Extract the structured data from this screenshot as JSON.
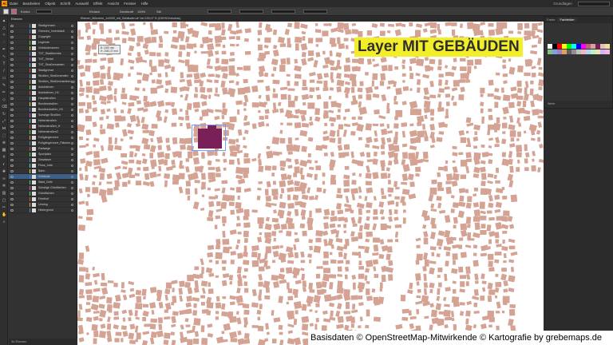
{
  "app": {
    "logo": "Ai"
  },
  "menu": {
    "items": [
      "Datei",
      "Bearbeiten",
      "Objekt",
      "Schrift",
      "Auswahl",
      "Effekt",
      "Ansicht",
      "Fenster",
      "Hilfe"
    ]
  },
  "topright": {
    "workspace": "Grundlagen"
  },
  "control": {
    "fill_color": "#c0607a",
    "stroke_label": "Kontur",
    "opacity_label": "Deckkraft",
    "opacity_value": "100%",
    "stil_label": "Stil",
    "basic": "Einfach"
  },
  "tools": {
    "icons": [
      "select-arrow",
      "direct-select",
      "magic-wand",
      "lasso",
      "pen",
      "curvature",
      "type",
      "line",
      "rectangle",
      "paintbrush",
      "pencil",
      "shaper",
      "eraser",
      "rotate",
      "scale",
      "width",
      "free-transform",
      "shape-builder",
      "perspective",
      "mesh",
      "gradient",
      "eyedropper",
      "blend",
      "symbol-sprayer",
      "graph",
      "artboard",
      "slice",
      "hand",
      "zoom"
    ]
  },
  "layers": {
    "tab": "Ebenen",
    "rows": [
      {
        "name": "Stadtgrenzen",
        "color": "#4a7fd8",
        "selected": false
      },
      {
        "name": "Grenzen_Innenstadt",
        "color": "#4a7fd8",
        "selected": false
      },
      {
        "name": "Copyright",
        "color": "#d84a4a",
        "selected": false
      },
      {
        "name": "Legende",
        "color": "#4ad84a",
        "selected": false
      },
      {
        "name": "Gebäudenamen",
        "color": "#d8d84a",
        "selected": false
      },
      {
        "name": "TXT_Stadtbezirke",
        "color": "#4a7fd8",
        "selected": false
      },
      {
        "name": "TXT_Viertel",
        "color": "#d84ad8",
        "selected": false
      },
      {
        "name": "TXT_Straßennamen",
        "color": "#4ad8d8",
        "selected": false
      },
      {
        "name": "Stadtgrenze",
        "color": "#d84a4a",
        "selected": false
      },
      {
        "name": "Straßen_Straßenenden",
        "color": "#4a7fd8",
        "selected": false
      },
      {
        "name": "Straßen_Straßenmarkierung",
        "color": "#d8a04a",
        "selected": false
      },
      {
        "name": "Autobahnen",
        "color": "#4ad84a",
        "selected": false
      },
      {
        "name": "Autobahnen_H1",
        "color": "#d84a4a",
        "selected": false
      },
      {
        "name": "Hauptstraßen",
        "color": "#4a7fd8",
        "selected": false
      },
      {
        "name": "Bundesstraßen",
        "color": "#d8d84a",
        "selected": false
      },
      {
        "name": "Bundesstraßen_H1",
        "color": "#4a7fd8",
        "selected": false
      },
      {
        "name": "Sonstige Straßen",
        "color": "#d84ad8",
        "selected": false
      },
      {
        "name": "Nebenstraßen",
        "color": "#4ad8d8",
        "selected": false
      },
      {
        "name": "Nebenstraßen_H",
        "color": "#d84a4a",
        "selected": false
      },
      {
        "name": "Nebenstraßen2",
        "color": "#4ad84a",
        "selected": false
      },
      {
        "name": "Fußgängerzone",
        "color": "#d8a04a",
        "selected": false
      },
      {
        "name": "Fußgängerzone_Flächen",
        "color": "#4a7fd8",
        "selected": false
      },
      {
        "name": "Radwege",
        "color": "#d84a4a",
        "selected": false
      },
      {
        "name": "Sportplatz",
        "color": "#4ad84a",
        "selected": false
      },
      {
        "name": "Gewässer",
        "color": "#4a7fd8",
        "selected": false
      },
      {
        "name": "Fluss_Linie",
        "color": "#4ad8d8",
        "selected": false
      },
      {
        "name": "Bahn",
        "color": "#d8d84a",
        "selected": false
      },
      {
        "name": "Gebäude",
        "color": "#4a7fd8",
        "selected": true
      },
      {
        "name": "Wald_Gelb",
        "color": "#4ad84a",
        "selected": false
      },
      {
        "name": "Sonstige Grünflächen",
        "color": "#d84ad8",
        "selected": false
      },
      {
        "name": "Grünflächen",
        "color": "#4ad84a",
        "selected": false
      },
      {
        "name": "Friedhof",
        "color": "#d84a4a",
        "selected": false
      },
      {
        "name": "Umring",
        "color": "#d8a04a",
        "selected": false
      },
      {
        "name": "Hintergrund",
        "color": "#4a7fd8",
        "selected": false
      }
    ],
    "footer": "34 Ebenen"
  },
  "document": {
    "tab": "Ebenen_München_1x2000_mit_Gebäuden.ai* bei 125,07 % (CMYK/Vorschau)"
  },
  "banner": {
    "text": "Layer MIT GEBÄUDEN"
  },
  "tooltip": {
    "line1": "B: 1383 mm",
    "line2": "H: 2340,37 mm"
  },
  "credits": {
    "left": "Basisdaten © OpenStreetMap-Mitwirkende",
    "right": "© Kartografie by grebemaps.de"
  },
  "swatches_panel": {
    "tabs": [
      "Farbe",
      "Farbfelder"
    ],
    "active": "Farbfelder",
    "footer": "Werte"
  },
  "map_colors": {
    "building": "#d4a394",
    "selected": "#7b1f59",
    "background": "#ffffff"
  }
}
